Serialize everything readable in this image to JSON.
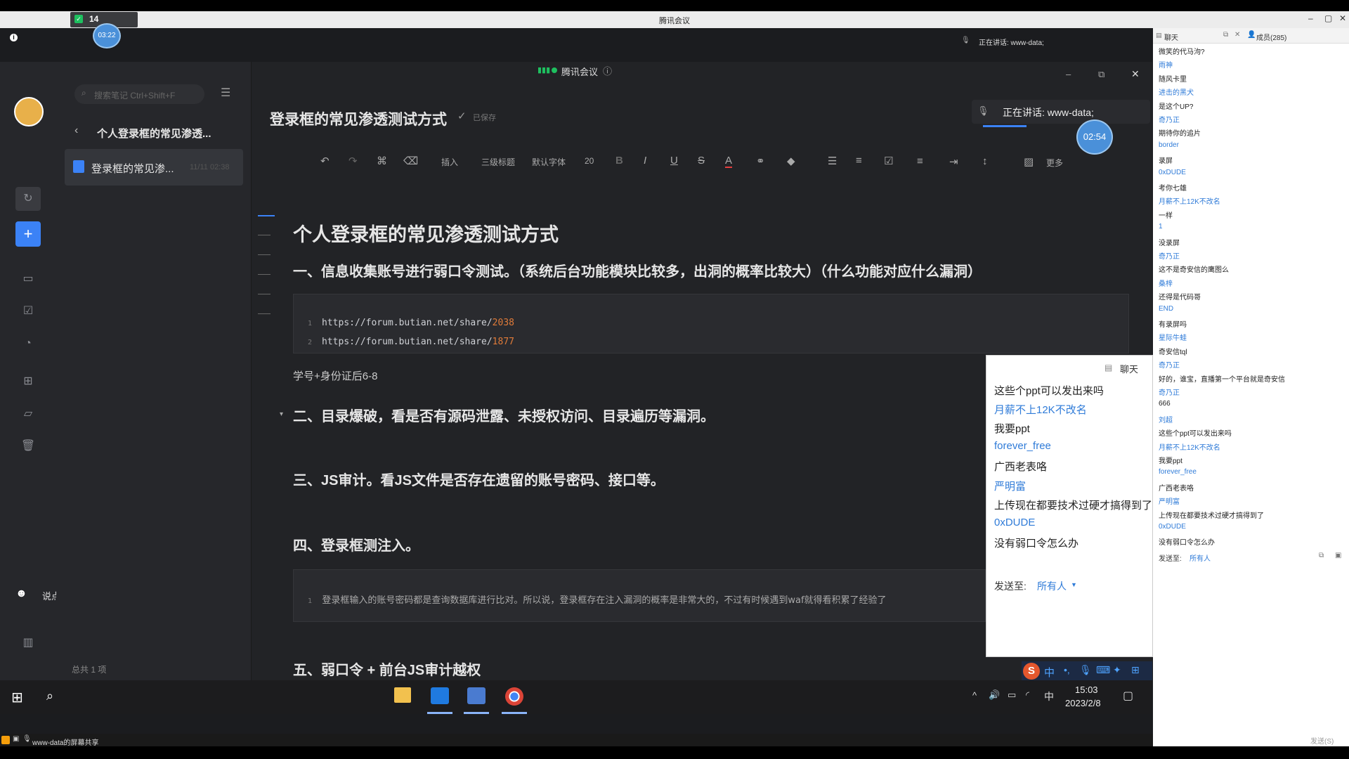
{
  "meeting": {
    "window_title": "腾讯会议",
    "timer_top": "03:22",
    "badge_count": "14",
    "speaking_label": "正在讲话: www-data;",
    "inner_app_title": "腾讯会议",
    "inner_timer": "02:54",
    "inner_speaking": "正在讲话: www-data;",
    "share_label": "www-data的屏幕共享"
  },
  "sidebar": {
    "search_placeholder": "搜索笔记 Ctrl+Shift+F",
    "folder_title": "个人登录框的常见渗透...",
    "doc_item": "登录框的常见渗...",
    "doc_item_date": "11/11 02:38",
    "footer": "总共 1 项"
  },
  "rail": {
    "comment_prompt": "说点什么..."
  },
  "doc": {
    "title": "登录框的常见渗透测试方式",
    "saved": "已保存",
    "toolbar": {
      "insert": "插入",
      "heading": "三级标题",
      "font": "默认字体",
      "size": "20",
      "more": "更多"
    },
    "h1": "个人登录框的常见渗透测试方式",
    "s1": "一、信息收集账号进行弱口令测试。（系统后台功能模块比较多，出洞的概率比较大）（什么功能对应什么漏洞）",
    "code1": [
      {
        "n": "1",
        "prefix": "https://forum.butian.net/share/",
        "num": "2038"
      },
      {
        "n": "2",
        "prefix": "https://forum.butian.net/share/",
        "num": "1877"
      }
    ],
    "p1": "学号+身份证后6-8",
    "s2": "二、目录爆破，看是否有源码泄露、未授权访问、目录遍历等漏洞。",
    "s3": "三、JS审计。看JS文件是否存在遗留的账号密码、接口等。",
    "s4": "四、登录框测注入。",
    "code2": {
      "n": "1",
      "text": "登录框输入的账号密码都是查询数据库进行比对。所以说，登录框存在注入漏洞的概率是非常大的，不过有时候遇到waf就得看积累了经验了"
    },
    "s5": "五、弱口令 + 前台JS审计越权"
  },
  "float_chat": {
    "title": "聊天",
    "lines": [
      {
        "type": "msg",
        "text": "这些个ppt可以发出来吗"
      },
      {
        "type": "name",
        "text": "月薪不上12K不改名"
      },
      {
        "type": "msg",
        "text": "我要ppt"
      },
      {
        "type": "name",
        "text": "forever_free"
      },
      {
        "type": "msg",
        "text": "广西老表咯"
      },
      {
        "type": "name",
        "text": "严明富"
      },
      {
        "type": "msg",
        "text": "上传现在都要技术过硬才搞得到了"
      },
      {
        "type": "name",
        "text": "0xDUDE"
      },
      {
        "type": "msg",
        "text": "没有弱口令怎么办"
      }
    ],
    "send_to_label": "发送至:",
    "send_to_value": "所有人"
  },
  "taskbar": {
    "time": "15:03",
    "date": "2023/2/8",
    "ime": "中"
  },
  "chat_panel": {
    "tab_chat": "聊天",
    "tab_members": "成员(285)",
    "lines": [
      {
        "type": "msg",
        "text": "微笑的代马泃?"
      },
      {
        "type": "name",
        "text": "雨神"
      },
      {
        "type": "msg",
        "text": "随风卡里"
      },
      {
        "type": "name",
        "text": "进击的黑犬"
      },
      {
        "type": "msg",
        "text": "是这个UP?"
      },
      {
        "type": "name",
        "text": "奇乃正"
      },
      {
        "type": "msg",
        "text": "期待你的追片"
      },
      {
        "type": "name",
        "text": "border"
      },
      {
        "type": "msg",
        "text": "录屏"
      },
      {
        "type": "name",
        "text": "0xDUDE"
      },
      {
        "type": "msg",
        "text": "考你七雄"
      },
      {
        "type": "name",
        "text": "月薪不上12K不改名"
      },
      {
        "type": "msg",
        "text": "一样"
      },
      {
        "type": "name",
        "text": "1"
      },
      {
        "type": "msg",
        "text": "没录屏"
      },
      {
        "type": "name",
        "text": "奇乃正"
      },
      {
        "type": "msg",
        "text": "这不是奇安信的鹰图么"
      },
      {
        "type": "name",
        "text": "桑梓"
      },
      {
        "type": "msg",
        "text": "还得是代码哥"
      },
      {
        "type": "name",
        "text": "END"
      },
      {
        "type": "msg",
        "text": "有录屏吗"
      },
      {
        "type": "name",
        "text": "星际牛蛙"
      },
      {
        "type": "msg",
        "text": "奇安信tql"
      },
      {
        "type": "name",
        "text": "奇乃正"
      },
      {
        "type": "msg",
        "text": "好的，谁宝，直播第一个平台就是奇安信"
      },
      {
        "type": "name",
        "text": "奇乃正"
      },
      {
        "type": "msg",
        "text": "666"
      },
      {
        "type": "name",
        "text": "刘超"
      },
      {
        "type": "msg",
        "text": "这些个ppt可以发出来吗"
      },
      {
        "type": "name",
        "text": "月薪不上12K不改名"
      },
      {
        "type": "msg",
        "text": "我要ppt"
      },
      {
        "type": "name",
        "text": "forever_free"
      },
      {
        "type": "msg",
        "text": "广西老表咯"
      },
      {
        "type": "name",
        "text": "严明富"
      },
      {
        "type": "msg",
        "text": "上传现在都要技术过硬才搞得到了"
      },
      {
        "type": "name",
        "text": "0xDUDE"
      },
      {
        "type": "msg",
        "text": "没有弱口令怎么办"
      }
    ],
    "send_to_label": "发送至:",
    "send_to_value": "所有人",
    "send_button": "发送(S)"
  },
  "colors": {
    "accent_green": "#1ec05f",
    "link_blue": "#2f7bd8",
    "code_orange": "#e07b39"
  }
}
